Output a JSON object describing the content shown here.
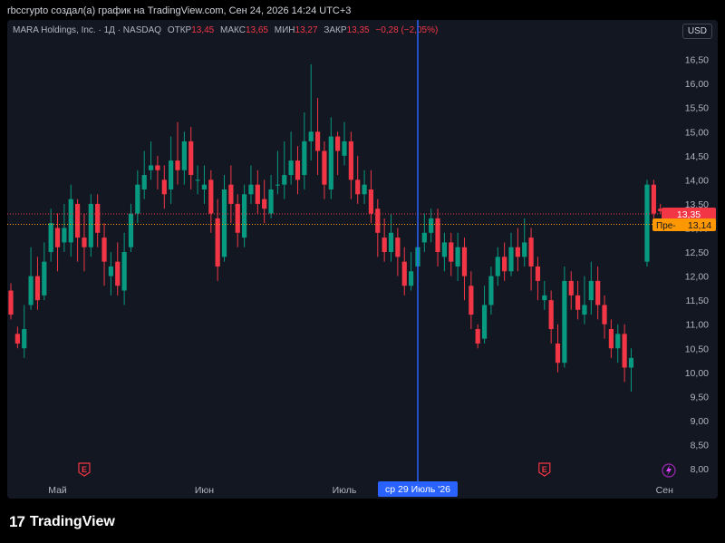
{
  "header": {
    "text": "rbccrypto создал(а) график на TradingView.com, Сен 24, 2026 14:24 UTC+3"
  },
  "symbol": {
    "name": "MARA Holdings, Inc. · 1Д · NASDAQ",
    "open_label": "ОТКР",
    "open": "13,45",
    "high_label": "МАКС",
    "high": "13,65",
    "low_label": "МИН",
    "low": "13,27",
    "close_label": "ЗАКР",
    "close": "13,35",
    "change": "−0,28 (−2,05%)"
  },
  "currency_button": "USD",
  "crosshair_label": "ср 29 Июль '26",
  "price_tags": {
    "last": "13,35",
    "pre_label": "Пре-",
    "pre": "13,14"
  },
  "footer": {
    "brand": "TradingView",
    "logo": "17"
  },
  "colors": {
    "up": "#089981",
    "down": "#f23645",
    "crosshair": "#2962ff",
    "pre": "#ff9800"
  },
  "chart_data": {
    "type": "candlestick",
    "y_axis_ticks": [
      "8,00",
      "8,50",
      "9,00",
      "9,50",
      "10,00",
      "10,50",
      "11,00",
      "11,50",
      "12,00",
      "12,50",
      "13,00",
      "13,50",
      "14,00",
      "14,50",
      "15,00",
      "15,50",
      "16,00",
      "16,50"
    ],
    "ylim": [
      7.85,
      16.85
    ],
    "x_axis_labels": [
      {
        "label": "Май",
        "day": 7
      },
      {
        "label": "Июн",
        "day": 29
      },
      {
        "label": "Июль",
        "day": 50
      },
      {
        "label": "Сен",
        "day": 98
      }
    ],
    "events": [
      {
        "label": "E",
        "day": 11
      },
      {
        "label": "E",
        "day": 80
      }
    ],
    "candles": [
      [
        11.7,
        11.2,
        11.85,
        11.1
      ],
      [
        10.8,
        10.6,
        10.95,
        10.5
      ],
      [
        10.5,
        10.9,
        11.4,
        10.3
      ],
      [
        11.4,
        12.0,
        12.6,
        11.3
      ],
      [
        12.0,
        11.5,
        12.4,
        11.3
      ],
      [
        11.6,
        12.3,
        12.7,
        11.5
      ],
      [
        12.5,
        13.1,
        13.4,
        12.3
      ],
      [
        13.0,
        12.6,
        13.3,
        12.1
      ],
      [
        12.7,
        13.0,
        13.5,
        12.5
      ],
      [
        12.7,
        13.6,
        13.9,
        12.4
      ],
      [
        13.5,
        12.8,
        13.6,
        12.3
      ],
      [
        12.8,
        12.6,
        13.3,
        12.1
      ],
      [
        12.6,
        13.5,
        13.7,
        12.4
      ],
      [
        13.5,
        12.9,
        13.7,
        12.6
      ],
      [
        12.8,
        12.3,
        13.1,
        11.8
      ],
      [
        12.0,
        12.2,
        12.5,
        11.6
      ],
      [
        12.3,
        11.8,
        12.7,
        11.6
      ],
      [
        11.7,
        12.5,
        12.9,
        11.4
      ],
      [
        12.6,
        13.3,
        13.5,
        12.5
      ],
      [
        13.3,
        13.9,
        14.2,
        13.1
      ],
      [
        13.8,
        14.1,
        14.6,
        13.6
      ],
      [
        14.2,
        14.3,
        14.8,
        14.0
      ],
      [
        14.3,
        14.2,
        14.5,
        13.8
      ],
      [
        14.0,
        13.7,
        14.3,
        13.4
      ],
      [
        13.8,
        14.4,
        14.9,
        13.5
      ],
      [
        14.4,
        14.2,
        15.2,
        13.9
      ],
      [
        14.2,
        14.8,
        15.0,
        13.9
      ],
      [
        14.8,
        14.1,
        15.1,
        13.8
      ],
      [
        14.0,
        14.0,
        14.3,
        13.7
      ],
      [
        13.8,
        13.9,
        14.3,
        13.5
      ],
      [
        14.0,
        13.3,
        14.2,
        12.9
      ],
      [
        13.2,
        12.2,
        13.6,
        11.9
      ],
      [
        12.4,
        13.8,
        14.1,
        12.3
      ],
      [
        13.9,
        13.5,
        14.3,
        13.1
      ],
      [
        13.5,
        12.9,
        13.7,
        12.6
      ],
      [
        12.8,
        13.7,
        13.9,
        12.6
      ],
      [
        13.7,
        13.9,
        14.3,
        13.5
      ],
      [
        13.9,
        13.5,
        14.2,
        13.3
      ],
      [
        13.6,
        13.4,
        14.0,
        13.1
      ],
      [
        13.3,
        13.8,
        14.1,
        13.2
      ],
      [
        13.9,
        13.9,
        14.6,
        13.7
      ],
      [
        13.9,
        14.1,
        14.8,
        13.6
      ],
      [
        14.1,
        14.4,
        15.0,
        13.9
      ],
      [
        14.4,
        14.0,
        14.7,
        13.7
      ],
      [
        14.1,
        14.8,
        15.4,
        13.8
      ],
      [
        14.8,
        15.0,
        16.4,
        14.4
      ],
      [
        15.0,
        14.6,
        15.7,
        14.1
      ],
      [
        14.6,
        13.9,
        14.8,
        13.6
      ],
      [
        13.8,
        14.9,
        15.3,
        13.6
      ],
      [
        14.9,
        14.6,
        15.0,
        14.1
      ],
      [
        14.5,
        14.8,
        15.2,
        14.3
      ],
      [
        14.8,
        14.0,
        15.0,
        13.6
      ],
      [
        14.0,
        13.7,
        14.5,
        13.5
      ],
      [
        13.7,
        13.9,
        14.2,
        13.5
      ],
      [
        13.8,
        13.3,
        14.2,
        13.1
      ],
      [
        13.4,
        12.9,
        13.6,
        12.4
      ],
      [
        12.8,
        12.5,
        13.2,
        12.3
      ],
      [
        12.5,
        12.9,
        13.3,
        12.3
      ],
      [
        12.8,
        12.4,
        13.0,
        12.0
      ],
      [
        12.3,
        11.8,
        12.6,
        11.6
      ],
      [
        11.8,
        12.1,
        12.5,
        11.7
      ],
      [
        12.2,
        12.6,
        13.0,
        12.0
      ],
      [
        12.7,
        12.9,
        13.3,
        12.5
      ],
      [
        12.9,
        13.2,
        13.4,
        12.7
      ],
      [
        13.2,
        12.5,
        13.4,
        12.2
      ],
      [
        12.4,
        12.7,
        12.9,
        12.1
      ],
      [
        12.7,
        12.3,
        12.9,
        12.0
      ],
      [
        12.2,
        12.6,
        12.9,
        11.9
      ],
      [
        12.6,
        12.0,
        12.8,
        11.5
      ],
      [
        11.8,
        11.2,
        12.1,
        10.9
      ],
      [
        10.9,
        10.6,
        11.0,
        10.5
      ],
      [
        10.7,
        11.4,
        11.8,
        10.6
      ],
      [
        11.4,
        12.0,
        12.2,
        11.2
      ],
      [
        12.0,
        12.4,
        12.6,
        11.8
      ],
      [
        12.4,
        12.1,
        12.7,
        11.9
      ],
      [
        12.1,
        12.6,
        12.9,
        12.0
      ],
      [
        12.6,
        12.4,
        13.0,
        12.1
      ],
      [
        12.4,
        12.7,
        13.2,
        12.2
      ],
      [
        12.8,
        12.2,
        13.0,
        11.7
      ],
      [
        12.2,
        11.9,
        12.4,
        11.5
      ],
      [
        11.5,
        11.6,
        11.9,
        11.3
      ],
      [
        11.5,
        10.9,
        11.7,
        10.6
      ],
      [
        10.6,
        10.2,
        11.0,
        10.0
      ],
      [
        10.2,
        11.9,
        12.2,
        10.1
      ],
      [
        11.9,
        11.6,
        12.1,
        11.3
      ],
      [
        11.6,
        11.3,
        11.9,
        11.1
      ],
      [
        11.2,
        11.4,
        12.0,
        11.0
      ],
      [
        11.5,
        11.9,
        12.3,
        11.2
      ],
      [
        11.9,
        11.4,
        12.2,
        11.1
      ],
      [
        11.4,
        11.0,
        11.6,
        10.7
      ],
      [
        10.9,
        10.5,
        11.1,
        10.3
      ],
      [
        10.5,
        10.8,
        11.0,
        10.2
      ],
      [
        10.8,
        10.1,
        11.0,
        9.8
      ],
      [
        10.1,
        10.3,
        10.5,
        9.6
      ]
    ]
  }
}
